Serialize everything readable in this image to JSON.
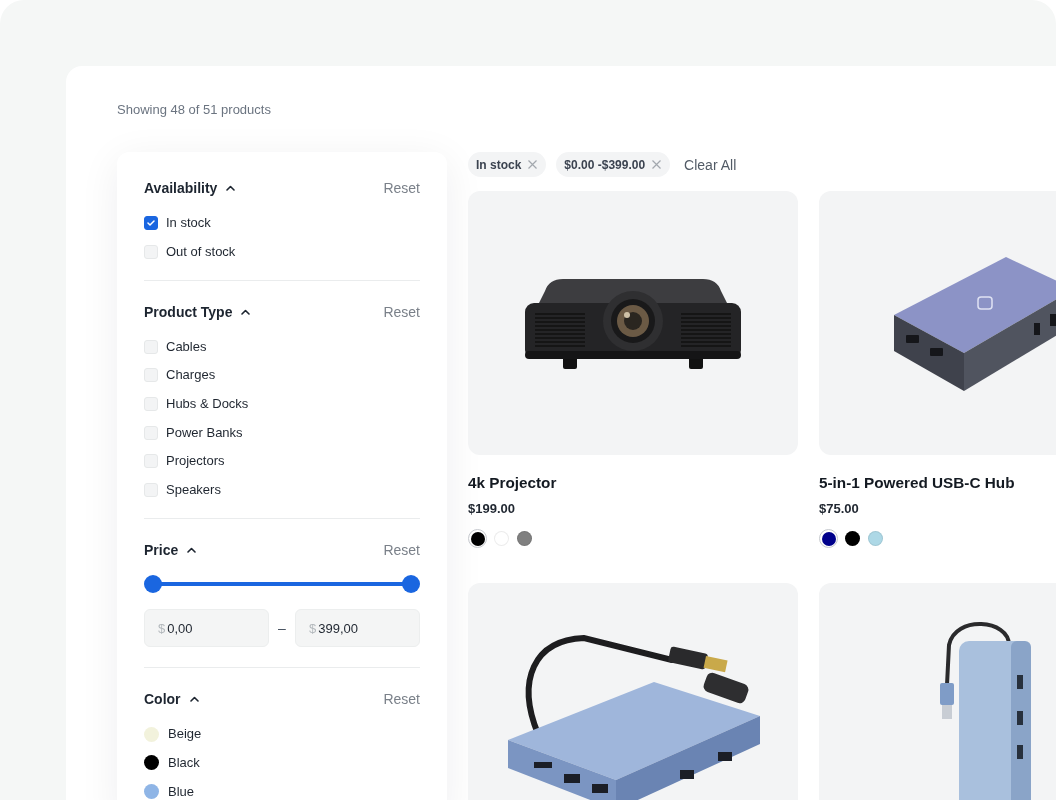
{
  "summary": "Showing 48 of 51 products",
  "filters": {
    "sections": [
      {
        "kind": "checkbox_list",
        "title": "Availability",
        "expanded": true,
        "reset": "Reset",
        "options": [
          {
            "label": "In stock",
            "checked": true
          },
          {
            "label": "Out of stock",
            "checked": false
          }
        ]
      },
      {
        "kind": "checkbox_list",
        "title": "Product Type",
        "expanded": true,
        "reset": "Reset",
        "options": [
          {
            "label": "Cables",
            "checked": false
          },
          {
            "label": "Charges",
            "checked": false
          },
          {
            "label": "Hubs & Docks",
            "checked": false
          },
          {
            "label": "Power Banks",
            "checked": false
          },
          {
            "label": "Projectors",
            "checked": false
          },
          {
            "label": "Speakers",
            "checked": false
          }
        ]
      },
      {
        "kind": "price_range",
        "title": "Price",
        "expanded": true,
        "reset": "Reset",
        "slider": {
          "thumbs": [
            {
              "level": 0
            },
            {
              "level": 1
            }
          ]
        },
        "min_field": {
          "prefix": "$",
          "value": "0,00"
        },
        "separator": "–",
        "max_field": {
          "prefix": "$",
          "value": "399,00"
        }
      },
      {
        "kind": "color_list",
        "title": "Color",
        "expanded": true,
        "reset": "Reset",
        "options": [
          {
            "label": "Beige",
            "color": "#f2f2dc"
          },
          {
            "label": "Black",
            "color": "#000000"
          },
          {
            "label": "Blue",
            "color": "#8fb5e6"
          }
        ]
      }
    ]
  },
  "active_filters": {
    "chips": [
      {
        "label": "In stock"
      },
      {
        "label": "$0.00 -$399.00"
      }
    ],
    "clear_all": "Clear All"
  },
  "products": [
    {
      "kind": "projector",
      "title": "4k Projector",
      "price": "$199.00",
      "swatches": [
        {
          "color": "#000000",
          "selected": true
        },
        {
          "color": "#ffffff",
          "selected": false
        },
        {
          "color": "#808080",
          "selected": false
        }
      ]
    },
    {
      "kind": "hub",
      "title": "5-in-1 Powered USB-C Hub",
      "price": "$75.00",
      "swatches": [
        {
          "color": "#00008b",
          "selected": true
        },
        {
          "color": "#000000",
          "selected": false
        },
        {
          "color": "#add8e6",
          "selected": false
        }
      ]
    },
    {
      "kind": "hub_with_cable"
    },
    {
      "kind": "power_bank"
    }
  ]
}
